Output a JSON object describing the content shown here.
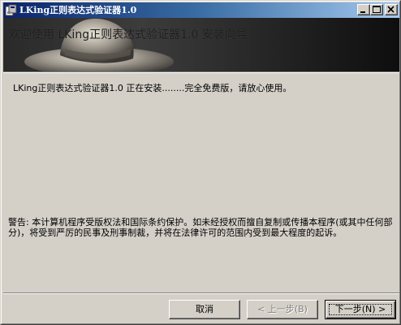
{
  "window": {
    "title": "LKing正则表达式验证器1.0",
    "controls": {
      "minimize_icon": "minimize-icon",
      "maximize_icon": "maximize-icon",
      "close_icon": "close-icon"
    }
  },
  "banner": {
    "title": "欢迎使用 LKing正则表达式验证器1.0 安装向导",
    "image": "hat-icon"
  },
  "body": {
    "install_status": "LKing正则表达式验证器1.0 正在安装........完全免费版，请放心使用。",
    "warning": "警告: 本计算机程序受版权法和国际条约保护。如未经授权而擅自复制或传播本程序(或其中任何部分)，将受到严厉的民事及刑事制裁，并将在法律许可的范围内受到最大程度的起诉。"
  },
  "buttons": {
    "cancel": "取消",
    "back": "< 上一步(B)",
    "next": "下一步(N) >"
  },
  "colors": {
    "titlebar_start": "#0a246a",
    "titlebar_end": "#a6caf0",
    "face": "#d4d0c8"
  }
}
